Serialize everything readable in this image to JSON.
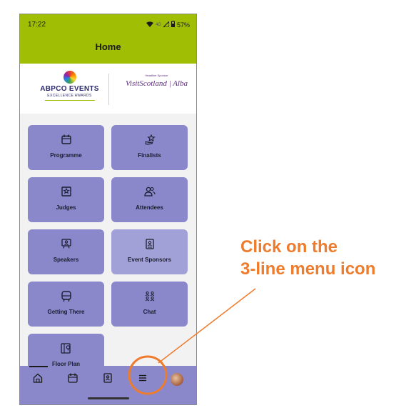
{
  "status_bar": {
    "time": "17:22",
    "signal": "4G",
    "battery": "57%"
  },
  "header": {
    "title": "Home"
  },
  "banner": {
    "left_logo": {
      "main": "ABPCO EVENTS",
      "sub": "EXCELLENCE AWARDS"
    },
    "right_logo": {
      "sponsor_label": "Headline Sponsor",
      "main": "VisitScotland | Alba"
    }
  },
  "tiles": [
    {
      "label": "Programme",
      "icon": "calendar-icon"
    },
    {
      "label": "Finalists",
      "icon": "star-hand-icon"
    },
    {
      "label": "Judges",
      "icon": "star-frame-icon"
    },
    {
      "label": "Attendees",
      "icon": "people-icon"
    },
    {
      "label": "Speakers",
      "icon": "presenter-icon"
    },
    {
      "label": "Event Sponsors",
      "icon": "sponsor-book-icon"
    },
    {
      "label": "Getting There",
      "icon": "bus-icon"
    },
    {
      "label": "Chat",
      "icon": "chat-group-icon"
    },
    {
      "label": "Floor Plan",
      "icon": "floor-map-icon"
    }
  ],
  "bottom_nav": [
    {
      "name": "home-icon",
      "active": true
    },
    {
      "name": "calendar-icon"
    },
    {
      "name": "contacts-icon"
    },
    {
      "name": "menu-icon"
    },
    {
      "name": "avatar"
    }
  ],
  "annotation": {
    "line1": "Click on the",
    "line2": "3-line menu icon",
    "color": "#ef7b2c"
  }
}
